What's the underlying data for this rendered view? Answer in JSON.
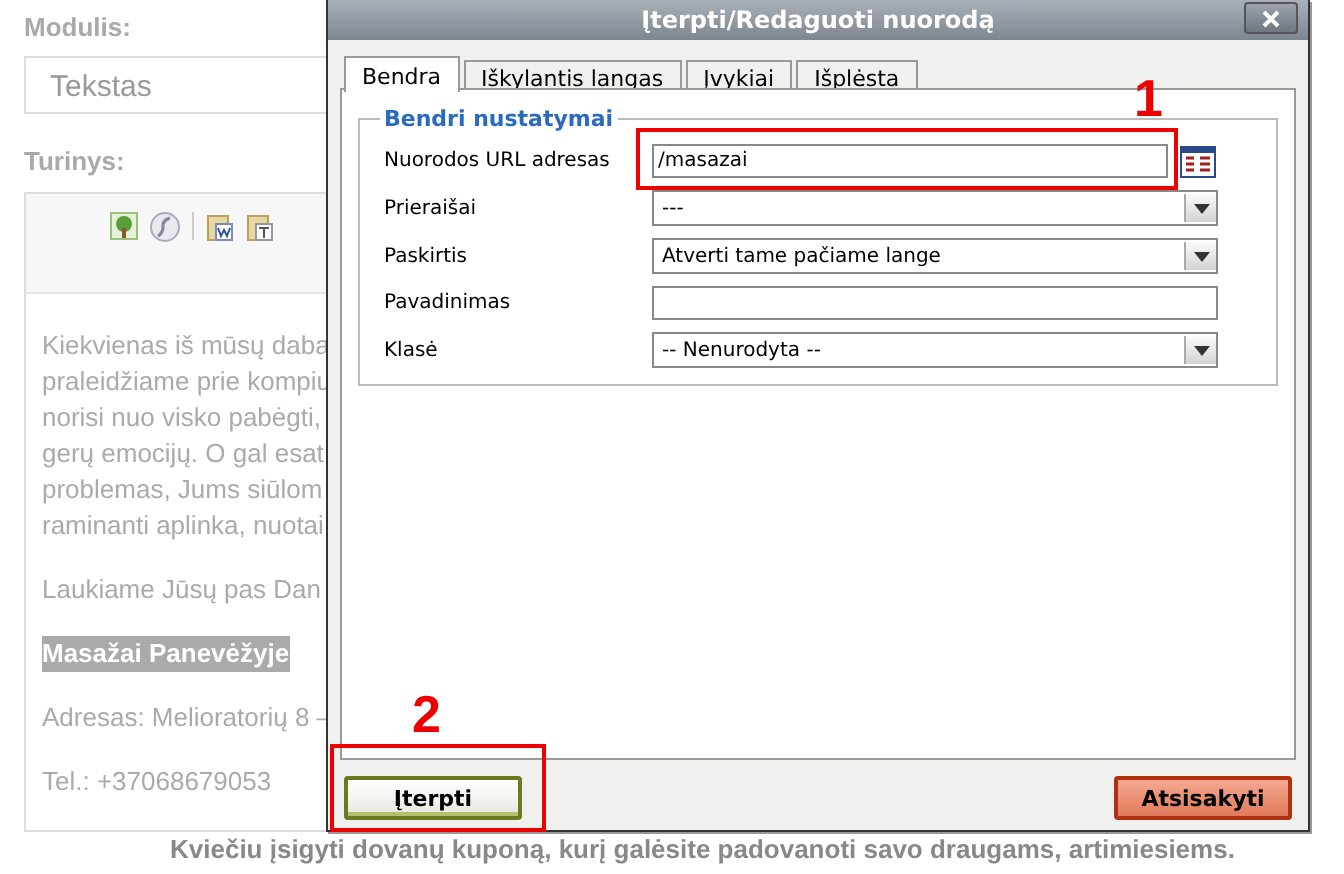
{
  "page": {
    "module_label": "Modulis:",
    "module_value": "Tekstas",
    "content_label": "Turinys:",
    "paragraphs": [
      {
        "kind": "text",
        "lines": [
          "Kiekvienas iš mūsų daba",
          "praleidžiame prie kompiu",
          "norisi nuo visko pabėgti,",
          "gerų emocijų. O gal esat",
          "problemas, Jums siūlom",
          "raminanti aplinka, nuotai"
        ]
      },
      {
        "kind": "text",
        "lines": [
          "Laukiame Jūsų pas Dan"
        ]
      },
      {
        "kind": "highlight",
        "lines": [
          "Masažai Panevėžyje"
        ]
      },
      {
        "kind": "text",
        "lines": [
          "Adresas: Melioratorių 8 –"
        ]
      },
      {
        "kind": "text",
        "lines": [
          "Tel.: +37068679053"
        ]
      },
      {
        "kind": "bold",
        "lines": [
          "Kviečiu įsigyti dovanų kuponą, kurį galėsite padovanoti savo draugams, artimiesiems."
        ]
      }
    ]
  },
  "dialog": {
    "title": "Įterpti/Redaguoti nuorodą",
    "tabs": [
      {
        "label": "Bendra",
        "selected": true
      },
      {
        "label": "Iškylantis langas",
        "selected": false
      },
      {
        "label": "Įvykiai",
        "selected": false
      },
      {
        "label": "Išplėsta",
        "selected": false
      }
    ],
    "fieldset": "Bendri nustatymai",
    "fields": [
      {
        "label": "Nuorodos URL adresas",
        "kind": "text",
        "value": "/masazai",
        "browse": true
      },
      {
        "label": "Prieraišai",
        "kind": "select",
        "value": "---"
      },
      {
        "label": "Paskirtis",
        "kind": "select",
        "value": "Atverti tame pačiame lange"
      },
      {
        "label": "Pavadinimas",
        "kind": "text"
      },
      {
        "label": "Klasė",
        "kind": "select",
        "value": "-- Nenurodyta --"
      }
    ],
    "insert_button": "Įterpti",
    "cancel_button": "Atsisakyti"
  },
  "annotations": [
    {
      "label": "1"
    },
    {
      "label": "2"
    }
  ]
}
